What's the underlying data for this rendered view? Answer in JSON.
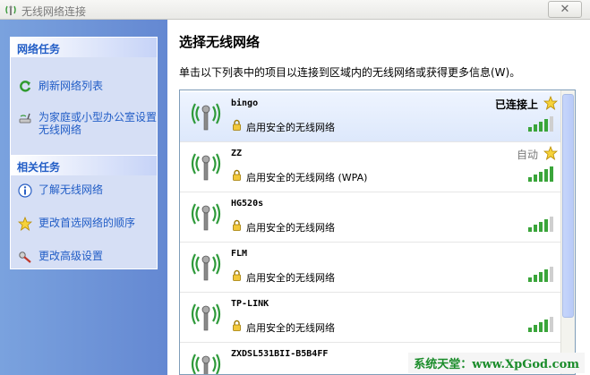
{
  "window": {
    "title": "无线网络连接",
    "close_label": "✕"
  },
  "left": {
    "network_tasks": {
      "header": "网络任务",
      "items": [
        {
          "label": "刷新网络列表",
          "icon": "refresh-icon"
        },
        {
          "label": "为家庭或小型办公室设置无线网络",
          "icon": "wireless-setup-icon"
        }
      ]
    },
    "related_tasks": {
      "header": "相关任务",
      "items": [
        {
          "label": "了解无线网络",
          "icon": "info-icon"
        },
        {
          "label": "更改首选网络的顺序",
          "icon": "star-icon"
        },
        {
          "label": "更改高级设置",
          "icon": "settings-icon"
        }
      ]
    }
  },
  "main": {
    "heading": "选择无线网络",
    "description": "单击以下列表中的项目以连接到区域内的无线网络或获得更多信息(W)。",
    "networks": [
      {
        "ssid": "bingo",
        "security": "启用安全的无线网络",
        "status": "已连接上",
        "preferred": true,
        "signal_bars": 4
      },
      {
        "ssid": "ZZ",
        "security": "启用安全的无线网络 (WPA)",
        "status": "自动",
        "preferred": true,
        "signal_bars": 5
      },
      {
        "ssid": "HG520s",
        "security": "启用安全的无线网络",
        "status": "",
        "preferred": false,
        "signal_bars": 4
      },
      {
        "ssid": "FLM",
        "security": "启用安全的无线网络",
        "status": "",
        "preferred": false,
        "signal_bars": 4
      },
      {
        "ssid": "TP-LINK",
        "security": "启用安全的无线网络",
        "status": "",
        "preferred": false,
        "signal_bars": 4
      },
      {
        "ssid": "ZXDSL531BII-B5B4FF",
        "security": "",
        "status": "",
        "preferred": false,
        "signal_bars": 0
      }
    ]
  },
  "watermark": "系统天堂：www.XpGod.com",
  "colors": {
    "task_link": "#215dc6",
    "left_pane": "#6e93d8",
    "watermark": "#1a8c2a"
  }
}
